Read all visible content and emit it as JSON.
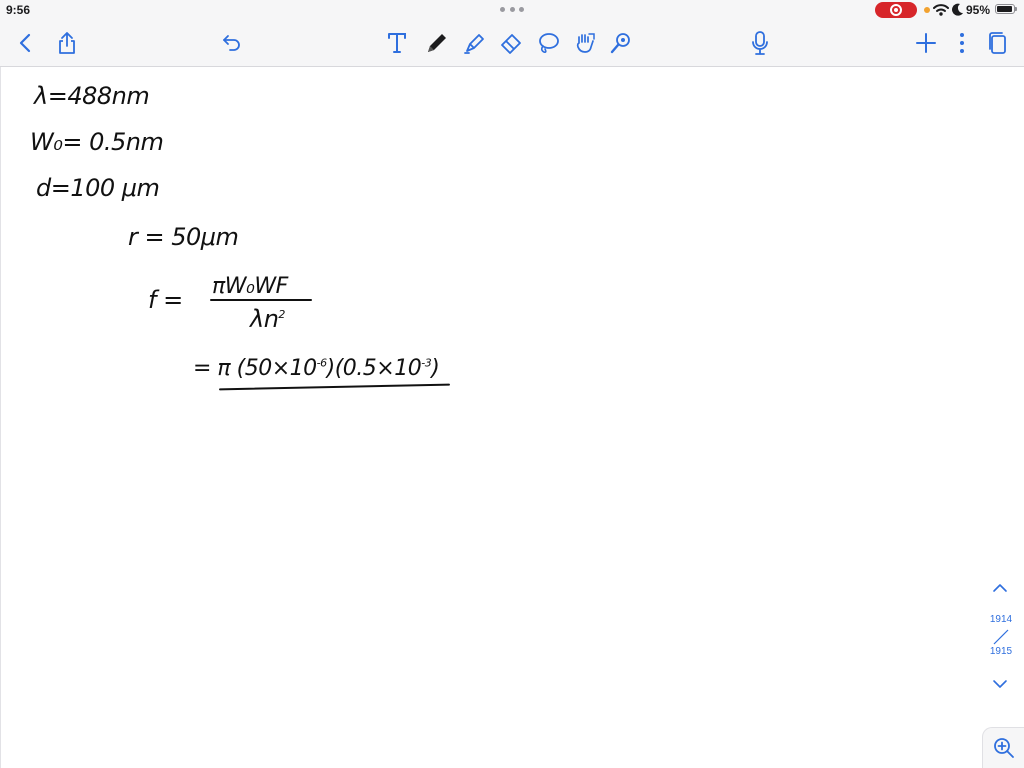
{
  "status_bar": {
    "time": "9:56",
    "battery_percent": "95%",
    "battery_level": 0.95,
    "recording": true,
    "accent_red": "#d7262a"
  },
  "toolbar": {
    "left": [
      "back-chevron-icon",
      "share-icon",
      "undo-icon"
    ],
    "tools": [
      "text-tool-icon",
      "pen-icon",
      "highlighter-icon",
      "eraser-icon",
      "lasso-icon",
      "shape-hand-icon",
      "laser-pointer-icon"
    ],
    "right": [
      "microphone-icon",
      "add-page-icon",
      "more-options-icon",
      "pages-icon"
    ],
    "accent_color": "#2f6fde",
    "selected_tool": "pen-icon"
  },
  "notes": {
    "line1": "λ=488nm",
    "line2": "W₀= 0.5nm",
    "line3": "d=100 μm",
    "line4": "r = 50μm",
    "fraction_label": "f =",
    "numerator": "πW₀WF",
    "denominator": "λn",
    "denominator_exp": "2",
    "line6_prefix": "= π (50×10",
    "line6_exp1": "-6",
    "line6_mid": ")(0.5×10",
    "line6_exp2": "-3",
    "line6_suffix": ")"
  },
  "navigator": {
    "current_page": "1914",
    "total_pages": "1915"
  }
}
